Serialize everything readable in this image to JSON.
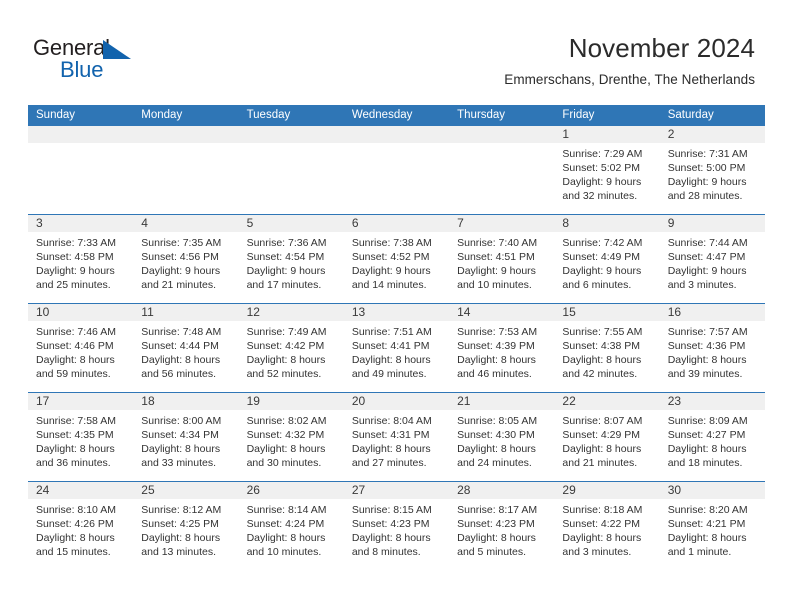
{
  "brand": {
    "name_part1": "General",
    "name_part2": "Blue",
    "accent_color": "#1263ad"
  },
  "header": {
    "title": "November 2024",
    "subtitle": "Emmerschans, Drenthe, The Netherlands"
  },
  "theme": {
    "header_blue": "#2f76b6",
    "daynum_band": "#f0f0f0"
  },
  "weekday_headers": [
    "Sunday",
    "Monday",
    "Tuesday",
    "Wednesday",
    "Thursday",
    "Friday",
    "Saturday"
  ],
  "weeks": [
    [
      {
        "day": "",
        "empty": true,
        "sunrise": "",
        "sunset": "",
        "daylight_line1": "",
        "daylight_line2": ""
      },
      {
        "day": "",
        "empty": true,
        "sunrise": "",
        "sunset": "",
        "daylight_line1": "",
        "daylight_line2": ""
      },
      {
        "day": "",
        "empty": true,
        "sunrise": "",
        "sunset": "",
        "daylight_line1": "",
        "daylight_line2": ""
      },
      {
        "day": "",
        "empty": true,
        "sunrise": "",
        "sunset": "",
        "daylight_line1": "",
        "daylight_line2": ""
      },
      {
        "day": "",
        "empty": true,
        "sunrise": "",
        "sunset": "",
        "daylight_line1": "",
        "daylight_line2": ""
      },
      {
        "day": "1",
        "empty": false,
        "sunrise": "Sunrise: 7:29 AM",
        "sunset": "Sunset: 5:02 PM",
        "daylight_line1": "Daylight: 9 hours",
        "daylight_line2": "and 32 minutes."
      },
      {
        "day": "2",
        "empty": false,
        "sunrise": "Sunrise: 7:31 AM",
        "sunset": "Sunset: 5:00 PM",
        "daylight_line1": "Daylight: 9 hours",
        "daylight_line2": "and 28 minutes."
      }
    ],
    [
      {
        "day": "3",
        "empty": false,
        "sunrise": "Sunrise: 7:33 AM",
        "sunset": "Sunset: 4:58 PM",
        "daylight_line1": "Daylight: 9 hours",
        "daylight_line2": "and 25 minutes."
      },
      {
        "day": "4",
        "empty": false,
        "sunrise": "Sunrise: 7:35 AM",
        "sunset": "Sunset: 4:56 PM",
        "daylight_line1": "Daylight: 9 hours",
        "daylight_line2": "and 21 minutes."
      },
      {
        "day": "5",
        "empty": false,
        "sunrise": "Sunrise: 7:36 AM",
        "sunset": "Sunset: 4:54 PM",
        "daylight_line1": "Daylight: 9 hours",
        "daylight_line2": "and 17 minutes."
      },
      {
        "day": "6",
        "empty": false,
        "sunrise": "Sunrise: 7:38 AM",
        "sunset": "Sunset: 4:52 PM",
        "daylight_line1": "Daylight: 9 hours",
        "daylight_line2": "and 14 minutes."
      },
      {
        "day": "7",
        "empty": false,
        "sunrise": "Sunrise: 7:40 AM",
        "sunset": "Sunset: 4:51 PM",
        "daylight_line1": "Daylight: 9 hours",
        "daylight_line2": "and 10 minutes."
      },
      {
        "day": "8",
        "empty": false,
        "sunrise": "Sunrise: 7:42 AM",
        "sunset": "Sunset: 4:49 PM",
        "daylight_line1": "Daylight: 9 hours",
        "daylight_line2": "and 6 minutes."
      },
      {
        "day": "9",
        "empty": false,
        "sunrise": "Sunrise: 7:44 AM",
        "sunset": "Sunset: 4:47 PM",
        "daylight_line1": "Daylight: 9 hours",
        "daylight_line2": "and 3 minutes."
      }
    ],
    [
      {
        "day": "10",
        "empty": false,
        "sunrise": "Sunrise: 7:46 AM",
        "sunset": "Sunset: 4:46 PM",
        "daylight_line1": "Daylight: 8 hours",
        "daylight_line2": "and 59 minutes."
      },
      {
        "day": "11",
        "empty": false,
        "sunrise": "Sunrise: 7:48 AM",
        "sunset": "Sunset: 4:44 PM",
        "daylight_line1": "Daylight: 8 hours",
        "daylight_line2": "and 56 minutes."
      },
      {
        "day": "12",
        "empty": false,
        "sunrise": "Sunrise: 7:49 AM",
        "sunset": "Sunset: 4:42 PM",
        "daylight_line1": "Daylight: 8 hours",
        "daylight_line2": "and 52 minutes."
      },
      {
        "day": "13",
        "empty": false,
        "sunrise": "Sunrise: 7:51 AM",
        "sunset": "Sunset: 4:41 PM",
        "daylight_line1": "Daylight: 8 hours",
        "daylight_line2": "and 49 minutes."
      },
      {
        "day": "14",
        "empty": false,
        "sunrise": "Sunrise: 7:53 AM",
        "sunset": "Sunset: 4:39 PM",
        "daylight_line1": "Daylight: 8 hours",
        "daylight_line2": "and 46 minutes."
      },
      {
        "day": "15",
        "empty": false,
        "sunrise": "Sunrise: 7:55 AM",
        "sunset": "Sunset: 4:38 PM",
        "daylight_line1": "Daylight: 8 hours",
        "daylight_line2": "and 42 minutes."
      },
      {
        "day": "16",
        "empty": false,
        "sunrise": "Sunrise: 7:57 AM",
        "sunset": "Sunset: 4:36 PM",
        "daylight_line1": "Daylight: 8 hours",
        "daylight_line2": "and 39 minutes."
      }
    ],
    [
      {
        "day": "17",
        "empty": false,
        "sunrise": "Sunrise: 7:58 AM",
        "sunset": "Sunset: 4:35 PM",
        "daylight_line1": "Daylight: 8 hours",
        "daylight_line2": "and 36 minutes."
      },
      {
        "day": "18",
        "empty": false,
        "sunrise": "Sunrise: 8:00 AM",
        "sunset": "Sunset: 4:34 PM",
        "daylight_line1": "Daylight: 8 hours",
        "daylight_line2": "and 33 minutes."
      },
      {
        "day": "19",
        "empty": false,
        "sunrise": "Sunrise: 8:02 AM",
        "sunset": "Sunset: 4:32 PM",
        "daylight_line1": "Daylight: 8 hours",
        "daylight_line2": "and 30 minutes."
      },
      {
        "day": "20",
        "empty": false,
        "sunrise": "Sunrise: 8:04 AM",
        "sunset": "Sunset: 4:31 PM",
        "daylight_line1": "Daylight: 8 hours",
        "daylight_line2": "and 27 minutes."
      },
      {
        "day": "21",
        "empty": false,
        "sunrise": "Sunrise: 8:05 AM",
        "sunset": "Sunset: 4:30 PM",
        "daylight_line1": "Daylight: 8 hours",
        "daylight_line2": "and 24 minutes."
      },
      {
        "day": "22",
        "empty": false,
        "sunrise": "Sunrise: 8:07 AM",
        "sunset": "Sunset: 4:29 PM",
        "daylight_line1": "Daylight: 8 hours",
        "daylight_line2": "and 21 minutes."
      },
      {
        "day": "23",
        "empty": false,
        "sunrise": "Sunrise: 8:09 AM",
        "sunset": "Sunset: 4:27 PM",
        "daylight_line1": "Daylight: 8 hours",
        "daylight_line2": "and 18 minutes."
      }
    ],
    [
      {
        "day": "24",
        "empty": false,
        "sunrise": "Sunrise: 8:10 AM",
        "sunset": "Sunset: 4:26 PM",
        "daylight_line1": "Daylight: 8 hours",
        "daylight_line2": "and 15 minutes."
      },
      {
        "day": "25",
        "empty": false,
        "sunrise": "Sunrise: 8:12 AM",
        "sunset": "Sunset: 4:25 PM",
        "daylight_line1": "Daylight: 8 hours",
        "daylight_line2": "and 13 minutes."
      },
      {
        "day": "26",
        "empty": false,
        "sunrise": "Sunrise: 8:14 AM",
        "sunset": "Sunset: 4:24 PM",
        "daylight_line1": "Daylight: 8 hours",
        "daylight_line2": "and 10 minutes."
      },
      {
        "day": "27",
        "empty": false,
        "sunrise": "Sunrise: 8:15 AM",
        "sunset": "Sunset: 4:23 PM",
        "daylight_line1": "Daylight: 8 hours",
        "daylight_line2": "and 8 minutes."
      },
      {
        "day": "28",
        "empty": false,
        "sunrise": "Sunrise: 8:17 AM",
        "sunset": "Sunset: 4:23 PM",
        "daylight_line1": "Daylight: 8 hours",
        "daylight_line2": "and 5 minutes."
      },
      {
        "day": "29",
        "empty": false,
        "sunrise": "Sunrise: 8:18 AM",
        "sunset": "Sunset: 4:22 PM",
        "daylight_line1": "Daylight: 8 hours",
        "daylight_line2": "and 3 minutes."
      },
      {
        "day": "30",
        "empty": false,
        "sunrise": "Sunrise: 8:20 AM",
        "sunset": "Sunset: 4:21 PM",
        "daylight_line1": "Daylight: 8 hours",
        "daylight_line2": "and 1 minute."
      }
    ]
  ]
}
